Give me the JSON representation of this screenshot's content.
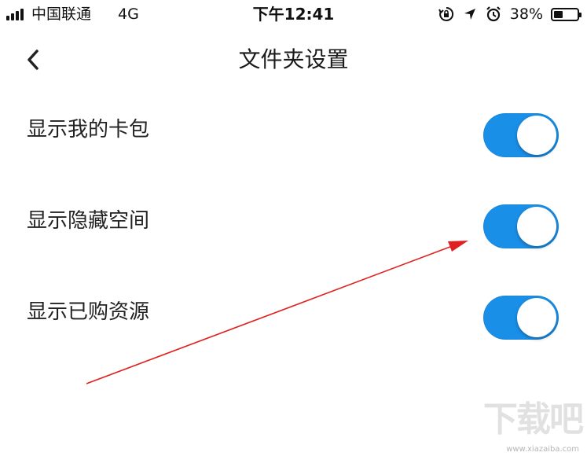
{
  "status_bar": {
    "carrier": "中国联通",
    "network": "4G",
    "time": "下午12:41",
    "battery_percent": "38%",
    "battery_level": 0.38,
    "icons": [
      "rotation-lock-icon",
      "location-icon",
      "alarm-icon",
      "battery-icon"
    ]
  },
  "nav": {
    "back_icon": "chevron-left-icon",
    "title": "文件夹设置"
  },
  "settings": [
    {
      "label": "显示我的卡包",
      "enabled": true
    },
    {
      "label": "显示隐藏空间",
      "enabled": true
    },
    {
      "label": "显示已购资源",
      "enabled": true
    }
  ],
  "colors": {
    "toggle_on": "#1a8fe8",
    "annotation_arrow": "#e02020",
    "background": "#ffffff"
  },
  "watermark": {
    "logo": "下载吧",
    "url": "www.xiazaiba.com"
  }
}
